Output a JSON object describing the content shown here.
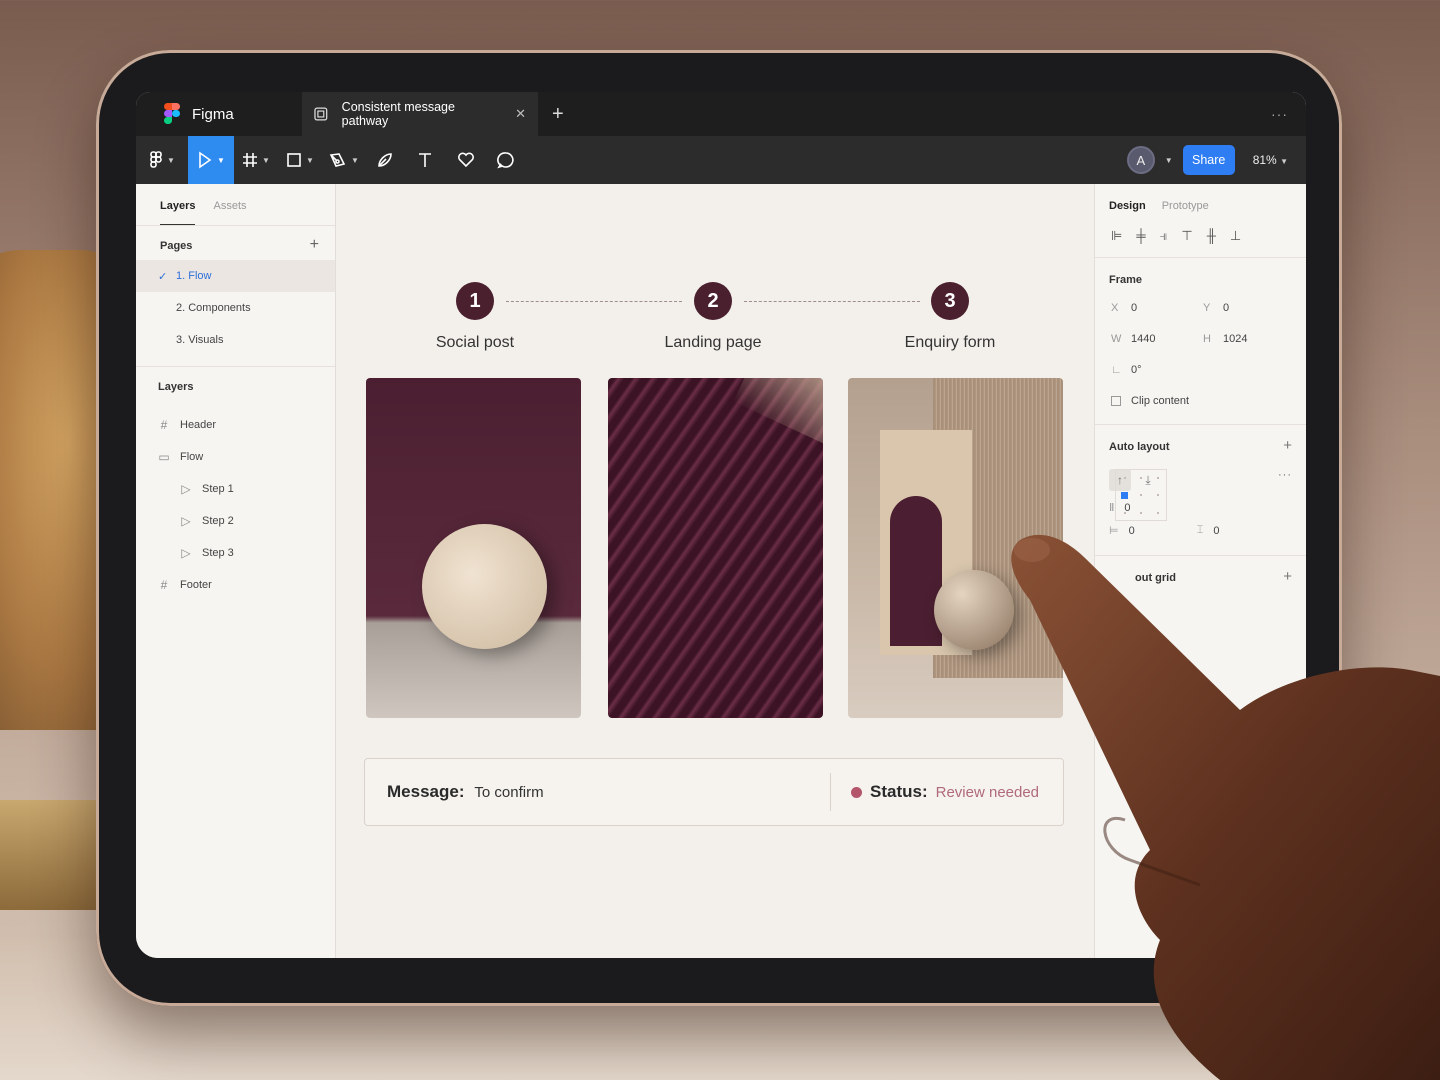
{
  "app": {
    "name": "Figma",
    "doc_title": "Consistent message pathway"
  },
  "toolbar": {
    "share_label": "Share",
    "zoom": "81%",
    "avatar_initial": "A"
  },
  "left_panel": {
    "tabs": [
      "Layers",
      "Assets"
    ],
    "pages_title": "Pages",
    "pages": [
      "1.  Flow",
      "2.  Components",
      "3.  Visuals"
    ],
    "layers_title": "Layers",
    "layers": [
      {
        "label": "Header",
        "icon": "frame-icon",
        "indent": 0
      },
      {
        "label": "Flow",
        "icon": "folder-icon",
        "indent": 0
      },
      {
        "label": "Step 1",
        "icon": "play-icon",
        "indent": 1
      },
      {
        "label": "Step 2",
        "icon": "play-icon",
        "indent": 1
      },
      {
        "label": "Step 3",
        "icon": "play-icon",
        "indent": 1
      },
      {
        "label": "Footer",
        "icon": "frame-icon",
        "indent": 0
      }
    ]
  },
  "canvas": {
    "steps": [
      {
        "num": "1",
        "label": "Social post"
      },
      {
        "num": "2",
        "label": "Landing page"
      },
      {
        "num": "3",
        "label": "Enquiry form"
      }
    ],
    "message_label": "Message:",
    "message_value": "To confirm",
    "status_label": "Status:",
    "status_value": "Review needed",
    "status_color": "#b4566b"
  },
  "right_panel": {
    "tabs": [
      "Design",
      "Prototype"
    ],
    "frame_title": "Frame",
    "x_label": "X",
    "x": "0",
    "y_label": "Y",
    "y": "0",
    "w_label": "W",
    "w": "1440",
    "h_label": "H",
    "h": "1024",
    "rotation": "0°",
    "clip_content": "Clip content",
    "auto_layout_title": "Auto layout",
    "gap": "0",
    "padding_h": "0",
    "padding_v": "0",
    "layout_grid_title": "out grid"
  },
  "colors": {
    "accent": "#2e7df2",
    "step": "#4a1f2e"
  }
}
